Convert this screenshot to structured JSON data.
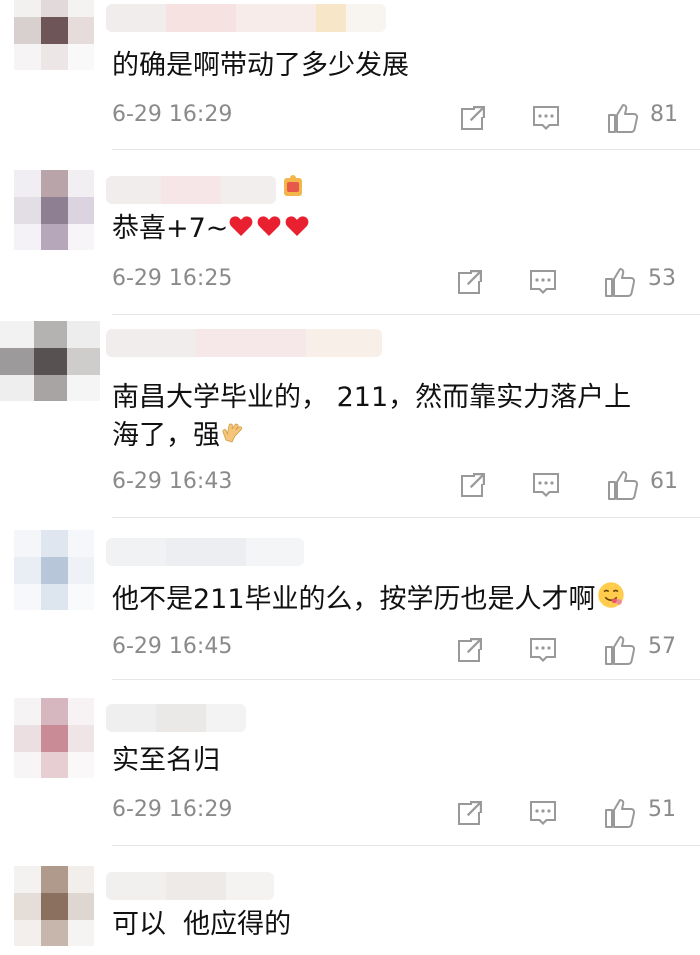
{
  "comments": [
    {
      "text": "的确是啊带动了多少发展",
      "time": "6-29 16:29",
      "likes": "81"
    },
    {
      "text": "恭喜+7~",
      "time": "6-29 16:25",
      "likes": "53",
      "emoji": [
        "red-heart",
        "red-heart",
        "red-heart"
      ]
    },
    {
      "text_line1": "南昌大学毕业的， 211，然而靠实力落户上",
      "text_line2": "海了，强",
      "time": "6-29 16:43",
      "likes": "61",
      "emoji": [
        "clap-hands"
      ]
    },
    {
      "text": "他不是211毕业的么，按学历也是人才啊",
      "time": "6-29 16:45",
      "likes": "57",
      "emoji": [
        "yummy-face"
      ]
    },
    {
      "text": "实至名归",
      "time": "6-29 16:29",
      "likes": "51"
    },
    {
      "text": "可以  他应得的"
    }
  ],
  "icons": {
    "share": "share-icon",
    "comment": "comment-icon",
    "like": "thumbs-up-icon"
  },
  "colors": {
    "meta": "#8a8a8a",
    "text": "#111111",
    "divider": "#e6e6e6",
    "heart": "#e8202f"
  }
}
